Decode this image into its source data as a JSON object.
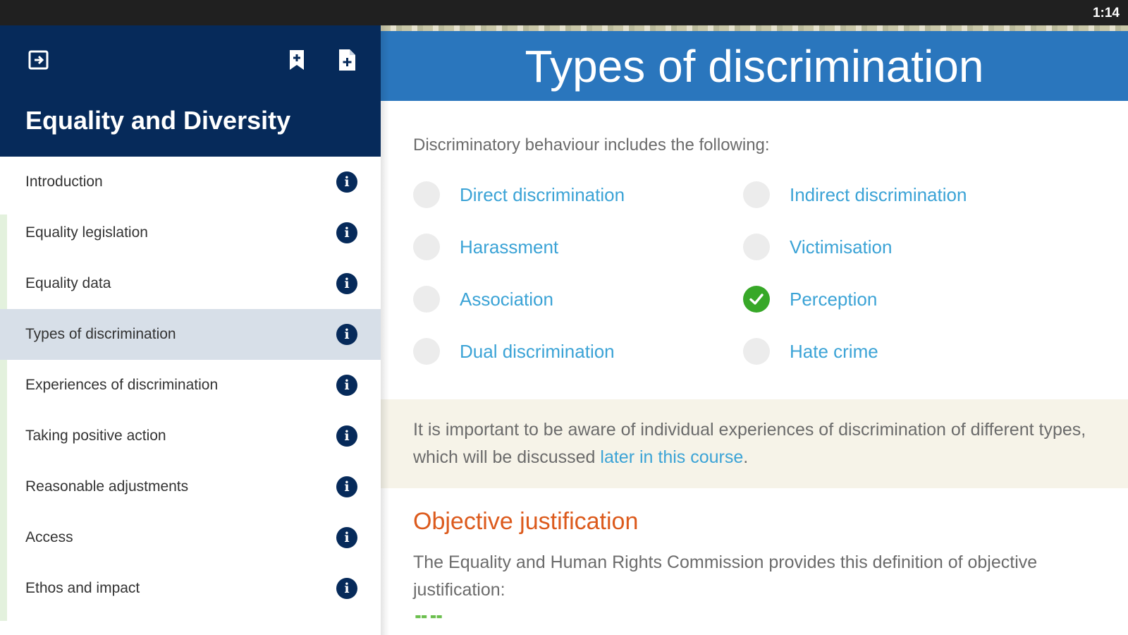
{
  "status_bar": {
    "time": "1:14"
  },
  "sidebar": {
    "course_title": "Equality and Diversity",
    "icons": {
      "exit": "exit-icon",
      "bookmark": "bookmark-add-icon",
      "notes": "note-add-icon"
    },
    "items": [
      {
        "label": "Introduction",
        "icon": "info-icon"
      },
      {
        "label": "Equality legislation",
        "icon": "info-icon"
      },
      {
        "label": "Equality data",
        "icon": "info-icon"
      },
      {
        "label": "Types of discrimination",
        "icon": "info-icon",
        "active": true
      },
      {
        "label": "Experiences of discrimination",
        "icon": "info-icon"
      },
      {
        "label": "Taking positive action",
        "icon": "info-icon"
      },
      {
        "label": "Reasonable adjustments",
        "icon": "info-icon"
      },
      {
        "label": "Access",
        "icon": "info-icon"
      },
      {
        "label": "Ethos and impact",
        "icon": "info-icon"
      }
    ]
  },
  "main": {
    "title": "Types of discrimination",
    "intro": "Discriminatory behaviour includes the following:",
    "types": [
      {
        "label": "Direct discrimination",
        "completed": false
      },
      {
        "label": "Indirect discrimination",
        "completed": false
      },
      {
        "label": "Harassment",
        "completed": false
      },
      {
        "label": "Victimisation",
        "completed": false
      },
      {
        "label": "Association",
        "completed": false
      },
      {
        "label": "Perception",
        "completed": true
      },
      {
        "label": "Dual discrimination",
        "completed": false
      },
      {
        "label": "Hate crime",
        "completed": false
      }
    ],
    "note": {
      "text_before": "It is important to be aware of individual experiences of discrimination of different types, which will be discussed ",
      "link": "later in this course",
      "text_after": "."
    },
    "section_heading": "Objective justification",
    "section_text": "The Equality and Human Rights Commission provides this definition of objective justification:"
  },
  "colors": {
    "sidebar_header": "#062a5a",
    "page_header": "#2a76bd",
    "link": "#3ba3d6",
    "heading_accent": "#dc5a1c",
    "completed": "#37a828",
    "active_item": "#d7dfe8",
    "note_bg": "#f6f3e8"
  }
}
